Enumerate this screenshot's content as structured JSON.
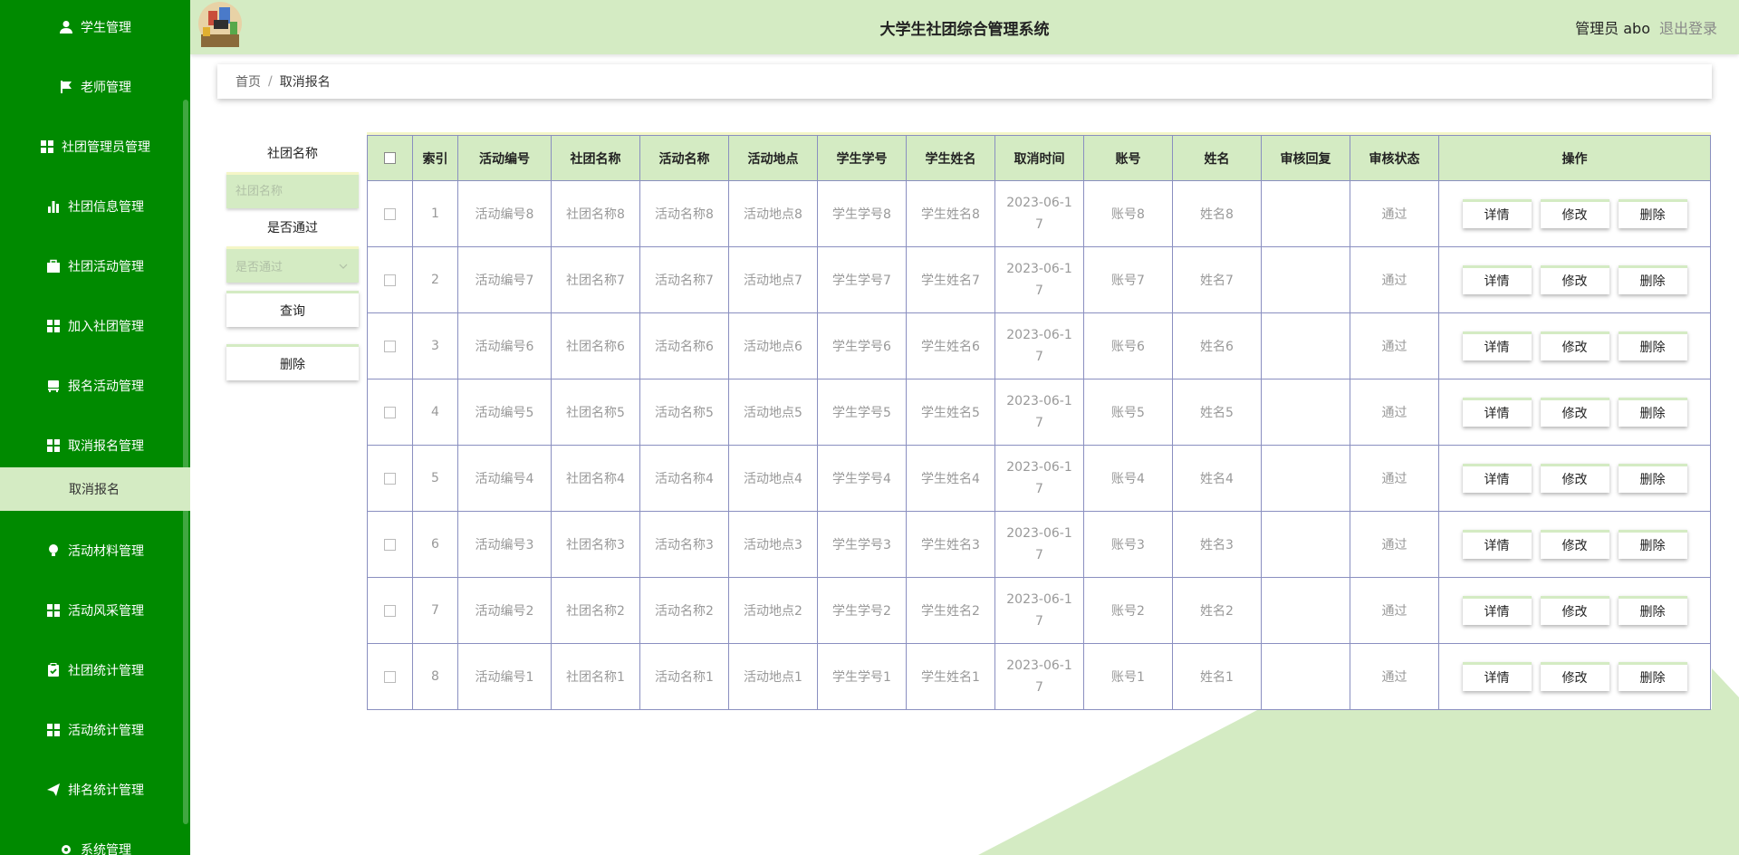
{
  "app": {
    "title": "大学生社团综合管理系统",
    "user": "管理员 abo",
    "logout": "退出登录"
  },
  "colors": {
    "sidebar": "#008a00",
    "accent_light": "#d4ebc3",
    "accent_yellow": "#f4f6c6",
    "table_border": "#8a8fc0"
  },
  "sidebar": {
    "items": [
      {
        "label": "学生管理",
        "icon": "user-icon"
      },
      {
        "label": "老师管理",
        "icon": "flag-icon"
      },
      {
        "label": "社团管理员管理",
        "icon": "grid-icon"
      },
      {
        "label": "社团信息管理",
        "icon": "bar-chart-icon"
      },
      {
        "label": "社团活动管理",
        "icon": "briefcase-icon"
      },
      {
        "label": "加入社团管理",
        "icon": "grid-icon"
      },
      {
        "label": "报名活动管理",
        "icon": "bed-icon"
      },
      {
        "label": "取消报名管理",
        "icon": "grid-icon"
      },
      {
        "label": "活动材料管理",
        "icon": "bulb-icon"
      },
      {
        "label": "活动风采管理",
        "icon": "grid-icon"
      },
      {
        "label": "社团统计管理",
        "icon": "clipboard-icon"
      },
      {
        "label": "活动统计管理",
        "icon": "grid-icon"
      },
      {
        "label": "排名统计管理",
        "icon": "send-icon"
      },
      {
        "label": "系统管理",
        "icon": "gear-icon"
      }
    ],
    "sub_item": "取消报名"
  },
  "breadcrumb": {
    "home": "首页",
    "separator": "/",
    "current": "取消报名"
  },
  "filter": {
    "club_label": "社团名称",
    "club_placeholder": "社团名称",
    "approved_label": "是否通过",
    "approved_placeholder": "是否通过",
    "query_button": "查询",
    "delete_button": "删除"
  },
  "table": {
    "headers": [
      "索引",
      "活动编号",
      "社团名称",
      "活动名称",
      "活动地点",
      "学生学号",
      "学生姓名",
      "取消时间",
      "账号",
      "姓名",
      "审核回复",
      "审核状态",
      "操作"
    ],
    "rows": [
      {
        "index": "1",
        "activity_no": "活动编号8",
        "club": "社团名称8",
        "activity_name": "活动名称8",
        "place": "活动地点8",
        "student_no": "学生学号8",
        "student_name": "学生姓名8",
        "time_line1": "2023-06-1",
        "time_line2": "7",
        "account": "账号8",
        "name": "姓名8",
        "reply": "",
        "status": "通过"
      },
      {
        "index": "2",
        "activity_no": "活动编号7",
        "club": "社团名称7",
        "activity_name": "活动名称7",
        "place": "活动地点7",
        "student_no": "学生学号7",
        "student_name": "学生姓名7",
        "time_line1": "2023-06-1",
        "time_line2": "7",
        "account": "账号7",
        "name": "姓名7",
        "reply": "",
        "status": "通过"
      },
      {
        "index": "3",
        "activity_no": "活动编号6",
        "club": "社团名称6",
        "activity_name": "活动名称6",
        "place": "活动地点6",
        "student_no": "学生学号6",
        "student_name": "学生姓名6",
        "time_line1": "2023-06-1",
        "time_line2": "7",
        "account": "账号6",
        "name": "姓名6",
        "reply": "",
        "status": "通过"
      },
      {
        "index": "4",
        "activity_no": "活动编号5",
        "club": "社团名称5",
        "activity_name": "活动名称5",
        "place": "活动地点5",
        "student_no": "学生学号5",
        "student_name": "学生姓名5",
        "time_line1": "2023-06-1",
        "time_line2": "7",
        "account": "账号5",
        "name": "姓名5",
        "reply": "",
        "status": "通过"
      },
      {
        "index": "5",
        "activity_no": "活动编号4",
        "club": "社团名称4",
        "activity_name": "活动名称4",
        "place": "活动地点4",
        "student_no": "学生学号4",
        "student_name": "学生姓名4",
        "time_line1": "2023-06-1",
        "time_line2": "7",
        "account": "账号4",
        "name": "姓名4",
        "reply": "",
        "status": "通过"
      },
      {
        "index": "6",
        "activity_no": "活动编号3",
        "club": "社团名称3",
        "activity_name": "活动名称3",
        "place": "活动地点3",
        "student_no": "学生学号3",
        "student_name": "学生姓名3",
        "time_line1": "2023-06-1",
        "time_line2": "7",
        "account": "账号3",
        "name": "姓名3",
        "reply": "",
        "status": "通过"
      },
      {
        "index": "7",
        "activity_no": "活动编号2",
        "club": "社团名称2",
        "activity_name": "活动名称2",
        "place": "活动地点2",
        "student_no": "学生学号2",
        "student_name": "学生姓名2",
        "time_line1": "2023-06-1",
        "time_line2": "7",
        "account": "账号2",
        "name": "姓名2",
        "reply": "",
        "status": "通过"
      },
      {
        "index": "8",
        "activity_no": "活动编号1",
        "club": "社团名称1",
        "activity_name": "活动名称1",
        "place": "活动地点1",
        "student_no": "学生学号1",
        "student_name": "学生姓名1",
        "time_line1": "2023-06-1",
        "time_line2": "7",
        "account": "账号1",
        "name": "姓名1",
        "reply": "",
        "status": "通过"
      }
    ],
    "actions": {
      "detail": "详情",
      "edit": "修改",
      "delete": "删除"
    }
  }
}
